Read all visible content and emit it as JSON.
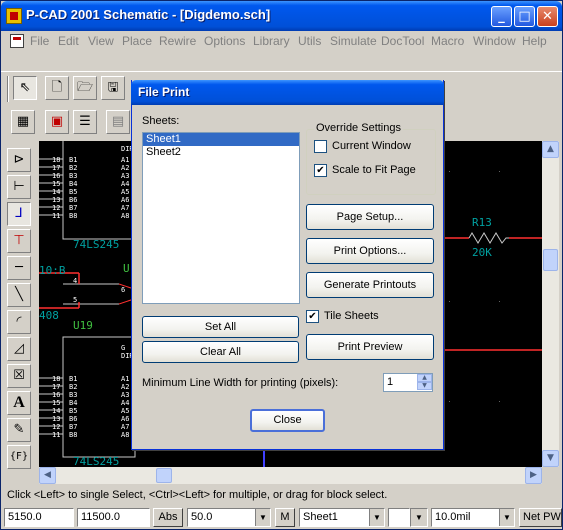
{
  "window": {
    "title": "P-CAD 2001 Schematic - [Digdemo.sch]",
    "min_glyph": "_",
    "max_glyph": "□",
    "close_glyph": "✕",
    "mdi_controls": "_ ▫ ×"
  },
  "menu": [
    "File",
    "Edit",
    "View",
    "Place",
    "Rewire",
    "Options",
    "Library",
    "Utils",
    "Simulate",
    "DocTool",
    "Macro",
    "Window",
    "Help"
  ],
  "canvas": {
    "chip1_pins_left": "18\n17\n16\n15\n14\n13\n12\n11",
    "chip1_pins_b": "B1\nB2\nB3\nB4\nB5\nB6\nB7\nB8",
    "chip1_pins_a": "A1\nA2\nA3\nA4\nA5\nA6\nA7\nA8",
    "chip1_dir": "DIR",
    "chip1_name": "74LS245",
    "chip2_pins_left": "18\n17\n16\n15\n14\n13\n12\n11",
    "chip2_pins_b": "B1\nB2\nB3\nB4\nB5\nB6\nB7\nB8",
    "chip2_pins_a": "A1\nA2\nA3\nA4\nA5\nA6\nA7\nA8",
    "chip2_dir": "G\nDIR",
    "chip2_name": "74LS245",
    "net1": "10:B",
    "net2": "408",
    "u19": "U19",
    "u_top": "U",
    "pin4": "4",
    "pin5": "5",
    "pin6": "6",
    "r13": "R13",
    "r13_val": "20K"
  },
  "dialog": {
    "title": "File Print",
    "sheets_label": "Sheets:",
    "sheets": [
      "Sheet1",
      "Sheet2"
    ],
    "selected_sheet": "Sheet1",
    "override_label": "Override Settings",
    "current_window_label": "Current Window",
    "current_window_checked": false,
    "scale_to_fit_label": "Scale to Fit Page",
    "scale_to_fit_checked": true,
    "page_setup": "Page Setup...",
    "print_options": "Print Options...",
    "generate_printouts": "Generate Printouts",
    "tile_sheets_label": "Tile Sheets",
    "tile_sheets_checked": true,
    "print_preview": "Print Preview",
    "set_all": "Set All",
    "clear_all": "Clear All",
    "min_line_label": "Minimum Line Width for printing (pixels):",
    "min_line_value": "1",
    "close": "Close"
  },
  "status": {
    "message": "Click <Left> to single Select, <Ctrl><Left> for multiple, or drag for block select.",
    "x": "5150.0",
    "y": "11500.0",
    "abs": "Abs",
    "grid": "50.0",
    "m": "M",
    "sheet": "Sheet1",
    "line_width": "10.0mil",
    "net": "Net PW"
  },
  "colors": {
    "accent": "#0054e3",
    "canvas_bg": "#000000",
    "wire_red": "#ff3030",
    "net_label_cyan": "#00a0a0",
    "part_label_green": "#40c040"
  }
}
